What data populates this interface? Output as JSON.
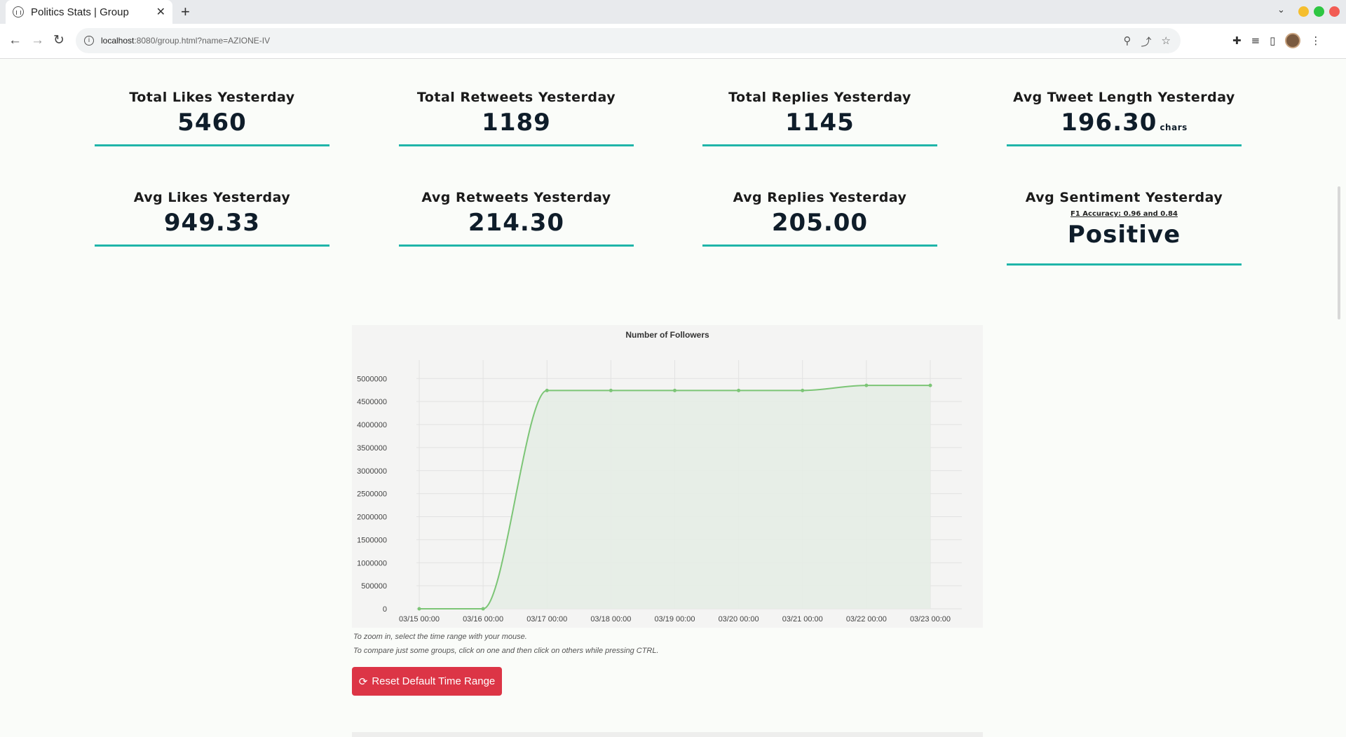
{
  "browser": {
    "tab_title": "Politics Stats | Group",
    "url_host": "localhost",
    "url_rest": ":8080/group.html?name=AZIONE-IV"
  },
  "stats_row1": [
    {
      "label": "Total Likes Yesterday",
      "value": "5460"
    },
    {
      "label": "Total Retweets Yesterday",
      "value": "1189"
    },
    {
      "label": "Total Replies Yesterday",
      "value": "1145"
    },
    {
      "label": "Avg Tweet Length Yesterday",
      "value": "196.30",
      "unit": "chars"
    }
  ],
  "stats_row2": [
    {
      "label": "Avg Likes Yesterday",
      "value": "949.33"
    },
    {
      "label": "Avg Retweets Yesterday",
      "value": "214.30"
    },
    {
      "label": "Avg Replies Yesterday",
      "value": "205.00"
    },
    {
      "label": "Avg Sentiment Yesterday",
      "link": "F1 Accuracy: 0.96 and 0.84",
      "value": "Positive"
    }
  ],
  "colors": {
    "accent": "#1fb5a9",
    "line": "#7cc576",
    "fill": "#e6ede5",
    "button": "#dc3546"
  },
  "chart_data": {
    "type": "area",
    "title": "Number of Followers",
    "x": [
      "03/15 00:00",
      "03/16 00:00",
      "03/17 00:00",
      "03/18 00:00",
      "03/19 00:00",
      "03/20 00:00",
      "03/21 00:00",
      "03/22 00:00",
      "03/23 00:00"
    ],
    "y": [
      0,
      0,
      4740000,
      4740000,
      4740000,
      4740000,
      4740000,
      4850000,
      4850000
    ],
    "ylim": [
      0,
      5400000
    ],
    "yticks": [
      "0",
      "500000",
      "1000000",
      "1500000",
      "2000000",
      "2500000",
      "3000000",
      "3500000",
      "4000000",
      "4500000",
      "5000000"
    ],
    "legend": "none",
    "grid": true
  },
  "hints": [
    "To zoom in, select the time range with your mouse.",
    "To compare just some groups, click on one and then click on others while pressing CTRL."
  ],
  "reset_button": "Reset Default Time Range"
}
